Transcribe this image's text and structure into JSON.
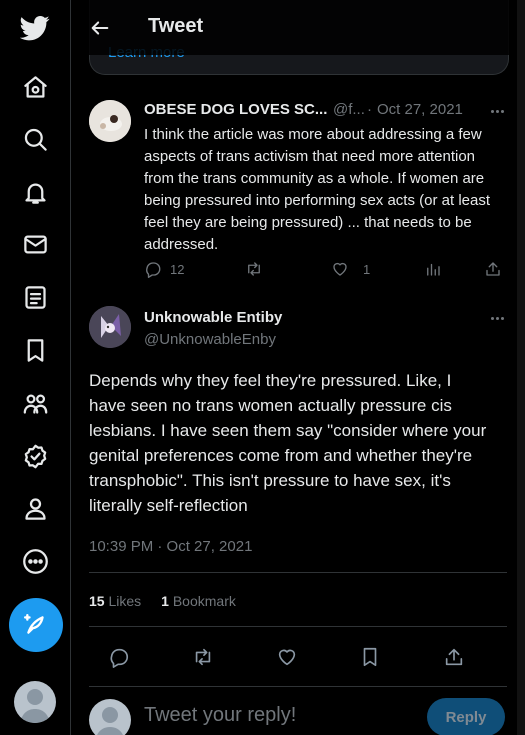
{
  "header": {
    "title": "Tweet",
    "quoted_card_link": "Learn more"
  },
  "nav": {
    "items": [
      {
        "name": "twitter-logo-icon"
      },
      {
        "name": "home-icon"
      },
      {
        "name": "explore-icon"
      },
      {
        "name": "notifications-icon"
      },
      {
        "name": "messages-icon"
      },
      {
        "name": "lists-icon"
      },
      {
        "name": "bookmarks-icon"
      },
      {
        "name": "communities-icon"
      },
      {
        "name": "verified-icon"
      },
      {
        "name": "profile-icon"
      },
      {
        "name": "more-icon"
      }
    ],
    "compose_icon": "compose-tweet-icon"
  },
  "reply_tweet": {
    "name": "OBESE DOG LOVES SC...",
    "handle": "@f...",
    "separator": "·",
    "date": "Oct 27, 2021",
    "text": "I think the article was more about addressing a few aspects of trans activism that need more attention from the trans community as a whole. If women are being pressured into performing sex acts (or at least feel they are being pressured) ... that needs to be addressed.",
    "reply_count": "12",
    "like_count": "1"
  },
  "main_tweet": {
    "name": "Unknowable Entiby",
    "handle": "@UnknowableEnby",
    "text": "Depends why they feel they're pressured. Like, I have seen no trans women actually pressure cis lesbians. I have seen them say \"consider where your genital preferences come from and whether they're transphobic\". This isn't pressure to have sex, it's literally self-reflection",
    "timestamp": "10:39 PM · Oct 27, 2021",
    "likes_count": "15",
    "likes_label": "Likes",
    "bookmarks_count": "1",
    "bookmarks_label": "Bookmark"
  },
  "reply_box": {
    "placeholder": "Tweet your reply!",
    "button_label": "Reply"
  },
  "colors": {
    "background": "#000000",
    "accent": "#1d9bf0",
    "text": "#e7e9ea",
    "muted": "#71767b",
    "border": "#2f3336",
    "reply_button_disabled": "#0f4e78"
  }
}
